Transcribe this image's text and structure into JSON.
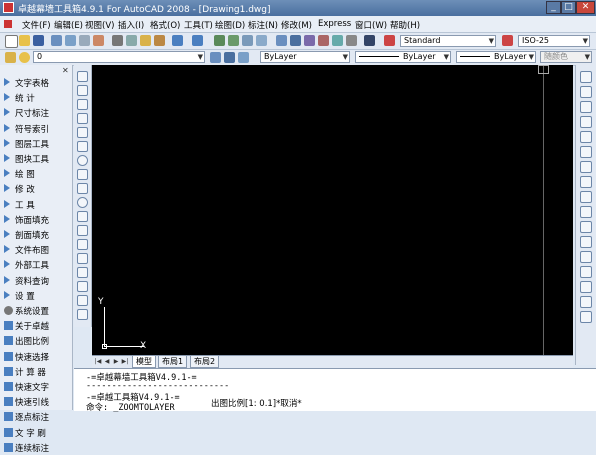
{
  "window": {
    "title": "卓越幕墙工具箱4.9.1 For AutoCAD 2008 - [Drawing1.dwg]",
    "controls": [
      "_",
      "□",
      "✕"
    ]
  },
  "menu": [
    "文件(F)",
    "编辑(E)",
    "视图(V)",
    "插入(I)",
    "格式(O)",
    "工具(T)",
    "绘图(D)",
    "标注(N)",
    "修改(M)",
    "Express",
    "窗口(W)",
    "帮助(H)"
  ],
  "toolbar": {
    "text_style": "Standard",
    "dim_style": "ISO-25",
    "layer": "0",
    "color": "ByLayer",
    "linetype": "ByLayer",
    "lineweight": "ByLayer",
    "plot_style": "随颜色"
  },
  "left_panel": {
    "close": "✕",
    "items": [
      {
        "label": "文字表格",
        "icon": "triangle"
      },
      {
        "label": "统    计",
        "icon": "triangle"
      },
      {
        "label": "尺寸标注",
        "icon": "triangle"
      },
      {
        "label": "符号索引",
        "icon": "triangle"
      },
      {
        "label": "图层工具",
        "icon": "triangle"
      },
      {
        "label": "图块工具",
        "icon": "triangle"
      },
      {
        "label": "绘    图",
        "icon": "triangle"
      },
      {
        "label": "修    改",
        "icon": "triangle"
      },
      {
        "label": "工    具",
        "icon": "triangle"
      },
      {
        "label": "饰面填充",
        "icon": "triangle"
      },
      {
        "label": "剖面填充",
        "icon": "triangle"
      },
      {
        "label": "文件布图",
        "icon": "triangle"
      },
      {
        "label": "外部工具",
        "icon": "triangle"
      },
      {
        "label": "资料查询",
        "icon": "triangle"
      },
      {
        "label": "设    置",
        "icon": "triangle"
      },
      {
        "label": "系统设置",
        "icon": "gear"
      },
      {
        "label": "关于卓越",
        "icon": "square"
      },
      {
        "label": "出图比例",
        "icon": "square"
      },
      {
        "label": "快速选择",
        "icon": "square"
      },
      {
        "label": "计 算 器",
        "icon": "square"
      },
      {
        "label": "快速文字",
        "icon": "square"
      },
      {
        "label": "快速引线",
        "icon": "square"
      },
      {
        "label": "逐点标注",
        "icon": "square"
      },
      {
        "label": "文 字 刷",
        "icon": "square"
      },
      {
        "label": "连续标注",
        "icon": "square"
      }
    ]
  },
  "canvas": {
    "ucs_x": "X",
    "ucs_y": "Y"
  },
  "tabs": [
    "模型",
    "布局1",
    "布局2"
  ],
  "command": {
    "lines": [
      "-=卓越幕墙工具箱V4.9.1-=",
      "----------------------------",
      "-=卓越工具箱V4.9.1-=",
      "命令: _ZOOMTOLAYER"
    ],
    "hint": "出图比例[1: 0.1]*取消*"
  },
  "colors": {
    "canvas": "#000000",
    "titlebar": "#4a6f9f",
    "panel_bg": "#e9eef6",
    "accent": "#4a7fc0"
  }
}
